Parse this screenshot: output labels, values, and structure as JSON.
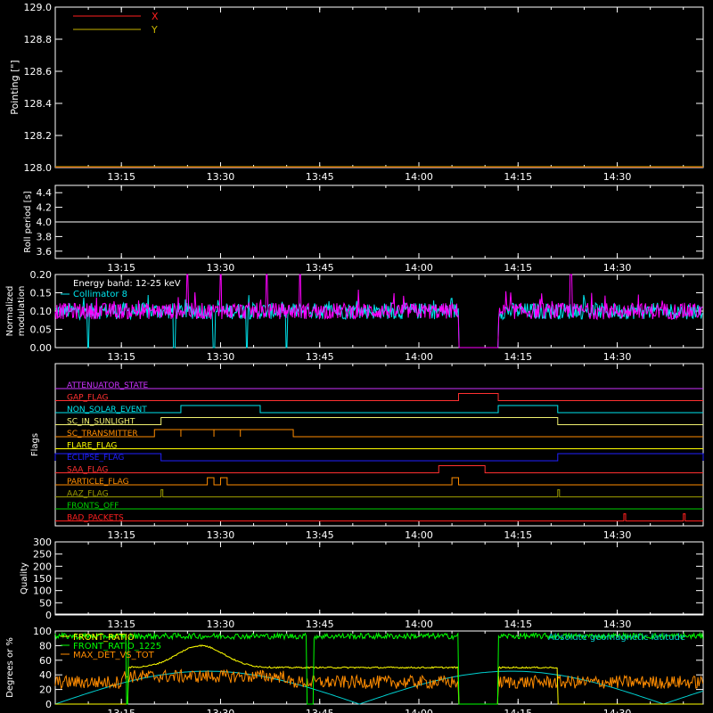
{
  "time_ticks": [
    "13:15",
    "13:30",
    "13:45",
    "14:00",
    "14:15",
    "14:30"
  ],
  "time_range": [
    "13:05",
    "14:43"
  ],
  "axis_color": "#ffffff",
  "chart_data": [
    {
      "type": "line",
      "ylabel": "Pointing [\"]",
      "ylim": [
        128.0,
        129.0
      ],
      "yticks": [
        "128.0",
        "128.2",
        "128.4",
        "128.6",
        "128.8",
        "129.0"
      ],
      "legend_placement": "top-left",
      "series": [
        {
          "name": "X",
          "color": "#ff2020",
          "value": 128.0
        },
        {
          "name": "Y",
          "color": "#c8b400",
          "value": 128.0
        }
      ]
    },
    {
      "type": "line",
      "ylabel": "Roll period [s]",
      "ylim": [
        3.5,
        4.5
      ],
      "yticks": [
        "3.6",
        "3.8",
        "4.0",
        "4.2",
        "4.4"
      ],
      "series": [
        {
          "color": "#ffffff",
          "value": 4.0
        }
      ]
    },
    {
      "type": "line",
      "ylabel": "Normalized\nmodulation",
      "ylim": [
        0.0,
        0.2
      ],
      "yticks": [
        "0.00",
        "0.05",
        "0.10",
        "0.15",
        "0.20"
      ],
      "annotations": [
        "Energy band: 12-25 keV",
        "Collimator 8"
      ],
      "series": [
        {
          "color": "#00e5ee",
          "baseline": 0.1,
          "gap": [
            "14:06",
            "14:12"
          ],
          "dips": [
            "13:10",
            "13:23",
            "13:29",
            "13:34",
            "13:40"
          ]
        },
        {
          "color": "#ff00ff",
          "baseline": 0.1,
          "gap": [
            "14:06",
            "14:12"
          ],
          "spikes": [
            "13:25",
            "13:30",
            "13:37",
            "13:42",
            "14:23"
          ]
        }
      ]
    },
    {
      "type": "line",
      "ylabel": "Flags",
      "flags": [
        {
          "name": "ATTENUATOR_STATE",
          "color": "#cc33ff",
          "segments": []
        },
        {
          "name": "GAP_FLAG",
          "color": "#ff3030",
          "segments": [
            [
              "14:06",
              "14:12"
            ]
          ]
        },
        {
          "name": "NON_SOLAR_EVENT",
          "color": "#00e5ee",
          "segments": [
            [
              "13:24",
              "13:36"
            ],
            [
              "14:12",
              "14:21"
            ]
          ]
        },
        {
          "name": "SC_IN_SUNLIGHT",
          "color": "#f0f070",
          "segments": [
            [
              "13:21",
              "14:21"
            ]
          ]
        },
        {
          "name": "SC_TRANSMITTER",
          "color": "#ff8c00",
          "segments": [
            [
              "13:20",
              "13:24"
            ],
            [
              "13:24",
              "13:29"
            ],
            [
              "13:29",
              "13:33"
            ],
            [
              "13:33",
              "13:41"
            ]
          ]
        },
        {
          "name": "FLARE_FLAG",
          "color": "#ffff00",
          "segments": []
        },
        {
          "name": "ECLIPSE_FLAG",
          "color": "#2020ff",
          "segments": [
            [
              "13:05",
              "13:21"
            ],
            [
              "14:21",
              "14:43"
            ]
          ]
        },
        {
          "name": "SAA_FLAG",
          "color": "#ff3030",
          "segments": [
            [
              "14:03",
              "14:10"
            ]
          ]
        },
        {
          "name": "PARTICLE_FLAG",
          "color": "#ff8c00",
          "segments": [
            [
              "13:28",
              "13:29"
            ],
            [
              "13:30",
              "13:31"
            ],
            [
              "14:05",
              "14:06"
            ]
          ]
        },
        {
          "name": "AAZ_FLAG",
          "color": "#9a9a00",
          "segments": [
            [
              "13:21",
              "13:21"
            ],
            [
              "14:21",
              "14:21"
            ]
          ]
        },
        {
          "name": "FRONTS_OFF",
          "color": "#00d000",
          "segments": []
        },
        {
          "name": "BAD_PACKETS",
          "color": "#ff2020",
          "segments": [
            [
              "14:31",
              "14:31"
            ],
            [
              "14:40",
              "14:40"
            ]
          ]
        }
      ]
    },
    {
      "type": "line",
      "ylabel": "Quality",
      "ylim": [
        0,
        300
      ],
      "yticks": [
        "0",
        "50",
        "100",
        "150",
        "200",
        "250",
        "300"
      ],
      "series": [
        {
          "color": "#ffffff",
          "value": 0
        }
      ]
    },
    {
      "type": "line",
      "ylabel": "Degrees or %",
      "ylim": [
        0,
        100
      ],
      "yticks": [
        "0",
        "20",
        "40",
        "60",
        "80",
        "100"
      ],
      "legend_placement": "top-left",
      "series": [
        {
          "name": "FRONT_RATIO",
          "color": "#ffff00",
          "baseline": 50
        },
        {
          "name": "FRONT_RATIO_1225",
          "color": "#00ff00",
          "baseline": 93
        },
        {
          "name": "MAX_DET_VS_TOT",
          "color": "#ff8c00",
          "baseline": 30
        }
      ],
      "extra_series": {
        "name": "Absolute geomagnetic latitude",
        "color": "#00d0d0",
        "legend_placement": "top-right"
      }
    }
  ]
}
